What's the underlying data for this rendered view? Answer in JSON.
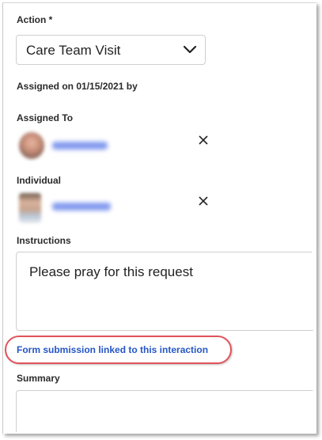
{
  "action": {
    "label": "Action *",
    "selected": "Care Team Visit"
  },
  "assigned": {
    "text": "Assigned on 01/15/2021 by"
  },
  "assigned_to": {
    "label": "Assigned To"
  },
  "individual": {
    "label": "Individual"
  },
  "instructions": {
    "label": "Instructions",
    "value": "Please pray for this request"
  },
  "form_link": {
    "text": "Form submission linked to this interaction"
  },
  "summary": {
    "label": "Summary",
    "value": ""
  },
  "colors": {
    "link": "#2456c5",
    "highlight": "#e0535b"
  },
  "icons": {
    "dropdown": "chevron-down-icon",
    "remove": "close-icon"
  }
}
